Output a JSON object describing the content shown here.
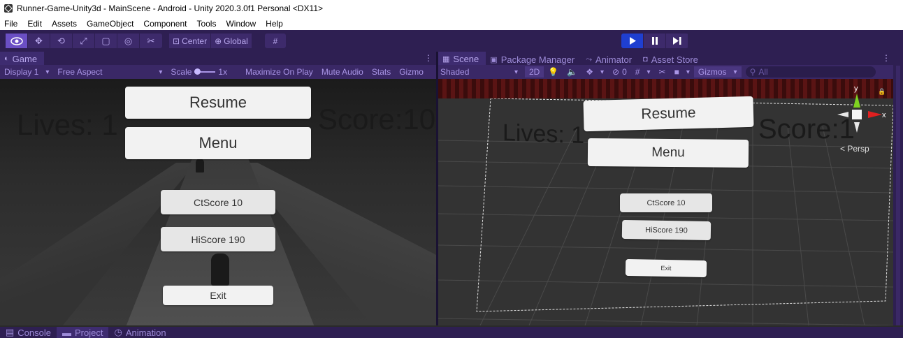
{
  "window": {
    "title": "Runner-Game-Unity3d - MainScene - Android - Unity 2020.3.0f1 Personal <DX11>"
  },
  "menu": [
    "File",
    "Edit",
    "Assets",
    "GameObject",
    "Component",
    "Tools",
    "Window",
    "Help"
  ],
  "toolbar": {
    "tools": [
      "view-tool",
      "move-tool",
      "rotate-tool",
      "scale-tool",
      "rect-tool",
      "transform-tool",
      "custom-tool"
    ],
    "pivot": "Center",
    "space": "Global"
  },
  "game_panel": {
    "tab": "Game",
    "controls": {
      "display": "Display 1",
      "aspect": "Free Aspect",
      "scale_label": "Scale",
      "scale_value": "1x",
      "maximize": "Maximize On Play",
      "mute": "Mute Audio",
      "stats": "Stats",
      "gizmos": "Gizmo"
    },
    "hud": {
      "lives": "Lives: 1",
      "score": "Score:10"
    },
    "buttons": {
      "resume": "Resume",
      "menu": "Menu",
      "ctscore": "CtScore 10",
      "hiscore": "HiScore 190",
      "exit": "Exit"
    }
  },
  "scene_panel": {
    "tabs": [
      "Scene",
      "Package Manager",
      "Animator",
      "Asset Store"
    ],
    "controls": {
      "shading": "Shaded",
      "mode_2d": "2D",
      "hidden_count": "0",
      "gizmos": "Gizmos",
      "search_placeholder": "All"
    },
    "hud": {
      "lives": "Lives: 1",
      "score": "Score:1"
    },
    "buttons": {
      "resume": "Resume",
      "menu": "Menu",
      "ctscore": "CtScore 10",
      "hiscore": "HiScore 190",
      "exit": "Exit"
    },
    "gizmo": {
      "y": "y",
      "x": "x",
      "projection": "Persp"
    }
  },
  "bottom_tabs": [
    "Console",
    "Project",
    "Animation"
  ],
  "colors": {
    "editor_purple": "#2e1f52",
    "tab_active": "#3e2c70",
    "play_active": "#1f3fd0"
  }
}
